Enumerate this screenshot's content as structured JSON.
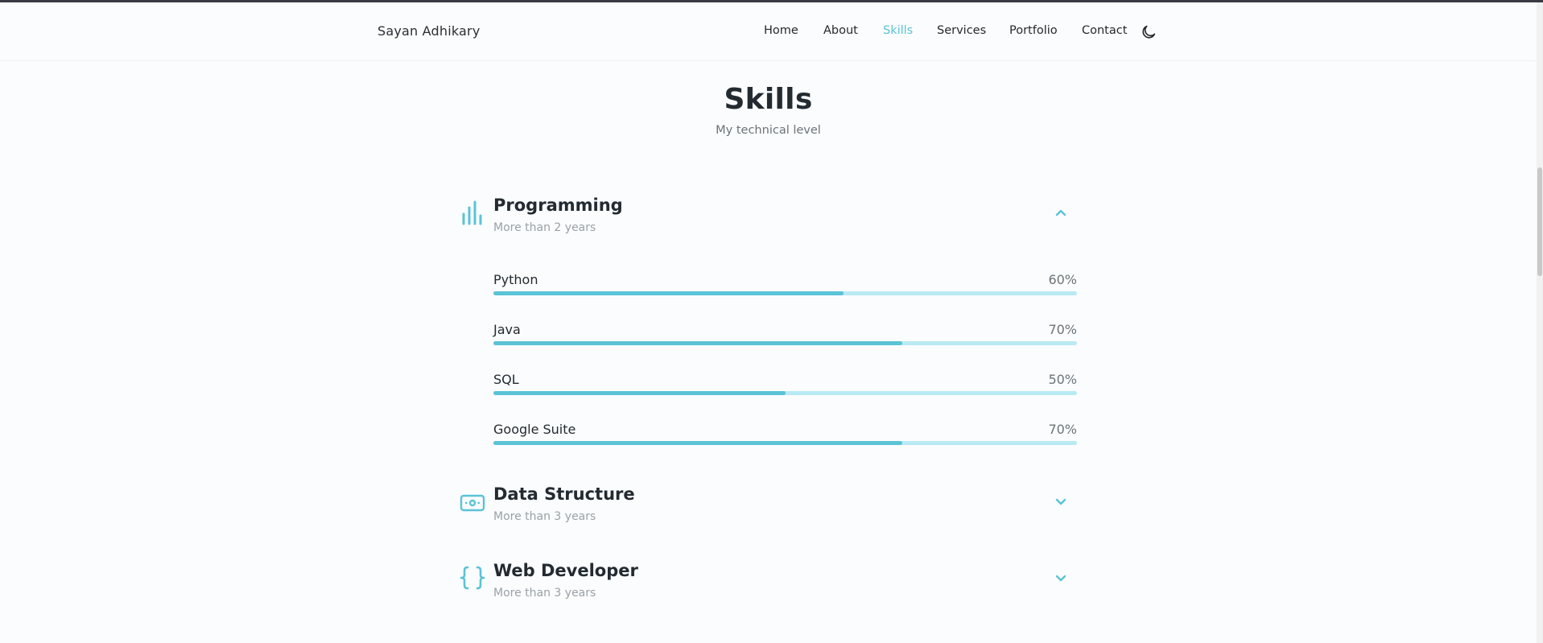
{
  "header": {
    "logo": "Sayan Adhikary",
    "nav": [
      {
        "label": "Home",
        "active": false
      },
      {
        "label": "About",
        "active": false
      },
      {
        "label": "Skills",
        "active": true
      },
      {
        "label": "Services",
        "active": false
      },
      {
        "label": "Portfolio",
        "active": false
      },
      {
        "label": "Contact",
        "active": false
      }
    ],
    "theme_toggle_icon": "moon-icon"
  },
  "section": {
    "title": "Skills",
    "subtitle": "My technical level"
  },
  "categories": [
    {
      "title": "Programming",
      "subtitle": "More than 2 years",
      "icon": "bar-chart-icon",
      "expanded": true,
      "chevron": "chevron-up-icon",
      "skills": [
        {
          "name": "Python",
          "percent_label": "60%",
          "percent": 60
        },
        {
          "name": "Java",
          "percent_label": "70%",
          "percent": 70
        },
        {
          "name": "SQL",
          "percent_label": "50%",
          "percent": 50
        },
        {
          "name": "Google Suite",
          "percent_label": "70%",
          "percent": 70
        }
      ]
    },
    {
      "title": "Data Structure",
      "subtitle": "More than 3 years",
      "icon": "money-bill-icon",
      "expanded": false,
      "chevron": "chevron-down-icon",
      "skills": []
    },
    {
      "title": "Web Developer",
      "subtitle": "More than 3 years",
      "icon": "braces-icon",
      "expanded": false,
      "chevron": "chevron-down-icon",
      "skills": []
    }
  ],
  "colors": {
    "accent": "#5bc3d6",
    "accent_light": "#b9eaf3",
    "text": "#232a30",
    "muted": "#9ba1a6"
  }
}
